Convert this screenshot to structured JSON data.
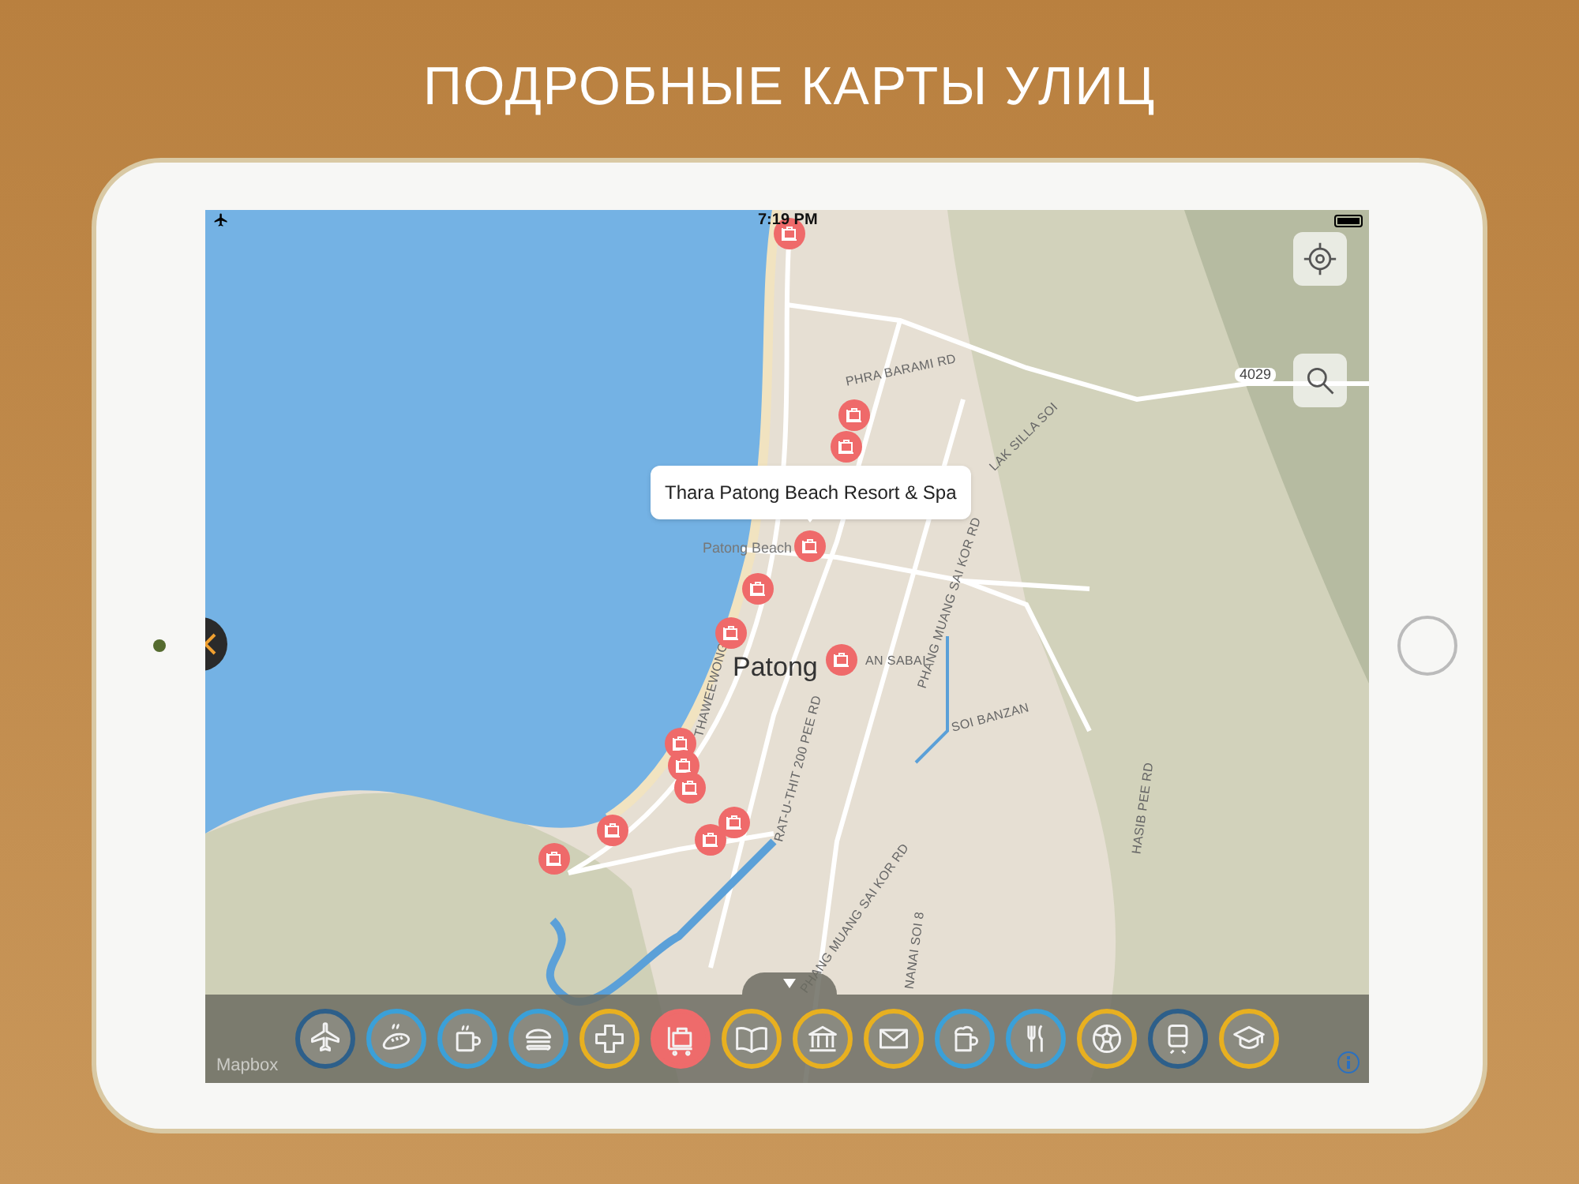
{
  "page_title": "ПОДРОБНЫЕ КАРТЫ УЛИЦ",
  "status_bar": {
    "time": "7:19 PM"
  },
  "map": {
    "callout": "Thara Patong Beach Resort & Spa",
    "labels": [
      {
        "text": "Patong",
        "kind": "town"
      },
      {
        "text": "Patong Beach",
        "kind": "place"
      },
      {
        "text": "PHRA BARAMI RD",
        "kind": "road"
      },
      {
        "text": "4029",
        "kind": "shield"
      },
      {
        "text": "LAK SILLA SOI",
        "kind": "road"
      },
      {
        "text": "RAT-U-THIT 200 PEE RD",
        "kind": "road"
      },
      {
        "text": "PHANG MUANG SAI KOR RD",
        "kind": "road"
      },
      {
        "text": "PHANG MUANG SAI KOR RD",
        "kind": "road"
      },
      {
        "text": "THAWEEWONG",
        "kind": "road"
      },
      {
        "text": "AN SABAI",
        "kind": "road"
      },
      {
        "text": "SOI BANZAN",
        "kind": "road"
      },
      {
        "text": "NANAI SOI 8",
        "kind": "road"
      },
      {
        "text": "HASIB PEE RD",
        "kind": "road"
      }
    ],
    "attribution": "Mapbox"
  },
  "categories": [
    {
      "color": "#2d5f8a",
      "selected": false
    },
    {
      "color": "#3ba0d8",
      "selected": false
    },
    {
      "color": "#3ba0d8",
      "selected": false
    },
    {
      "color": "#3ba0d8",
      "selected": false
    },
    {
      "color": "#e8b020",
      "selected": false
    },
    {
      "color": "#ee6b6b",
      "selected": true
    },
    {
      "color": "#e8b020",
      "selected": false
    },
    {
      "color": "#e8b020",
      "selected": false
    },
    {
      "color": "#e8b020",
      "selected": false
    },
    {
      "color": "#3ba0d8",
      "selected": false
    },
    {
      "color": "#3ba0d8",
      "selected": false
    },
    {
      "color": "#e8b020",
      "selected": false
    },
    {
      "color": "#2d5f8a",
      "selected": false
    },
    {
      "color": "#e8b020",
      "selected": false
    }
  ]
}
